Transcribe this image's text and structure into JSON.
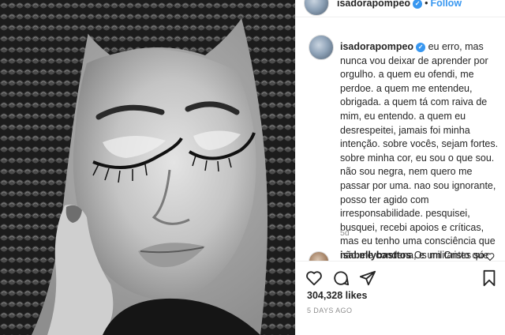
{
  "header": {
    "username": "isadorapompeo",
    "verified_glyph": "✓",
    "separator": "•",
    "follow_label": "Follow"
  },
  "caption": {
    "username": "isadorapompeo",
    "text": "eu erro, mas nunca vou deixar de aprender por orgulho. a quem eu ofendi, me perdoe. a quem me entendeu, obrigada. a quem tá com raiva de mim, eu entendo. a quem eu desrespeitei, jamais foi minha intenção. sobre vocês, sejam fortes. sobre minha cor, eu sou o que sou. não sou negra, nem quero me passar por uma. nao sou ignorante, posso ter agido com irresponsabilidade. pesquisei, busquei, recebi apoios e críticas, mas eu tenho uma consciência que não me condena, e um Cristo que não atira pedras em mim. a quem nunca errou, que atire a primeira pedra. com amor, eu.",
    "time": "5d"
  },
  "comment": {
    "username": "isabellybasttos",
    "text": "Os militantes só"
  },
  "actions": {
    "icons": [
      "heart-icon",
      "comment-icon",
      "share-icon",
      "bookmark-icon"
    ],
    "likes": "304,328 likes",
    "date": "5 DAYS AGO"
  },
  "colors": {
    "link_blue": "#3897f0",
    "text": "#262626",
    "muted": "#8e8e8e",
    "border": "#efefef"
  }
}
